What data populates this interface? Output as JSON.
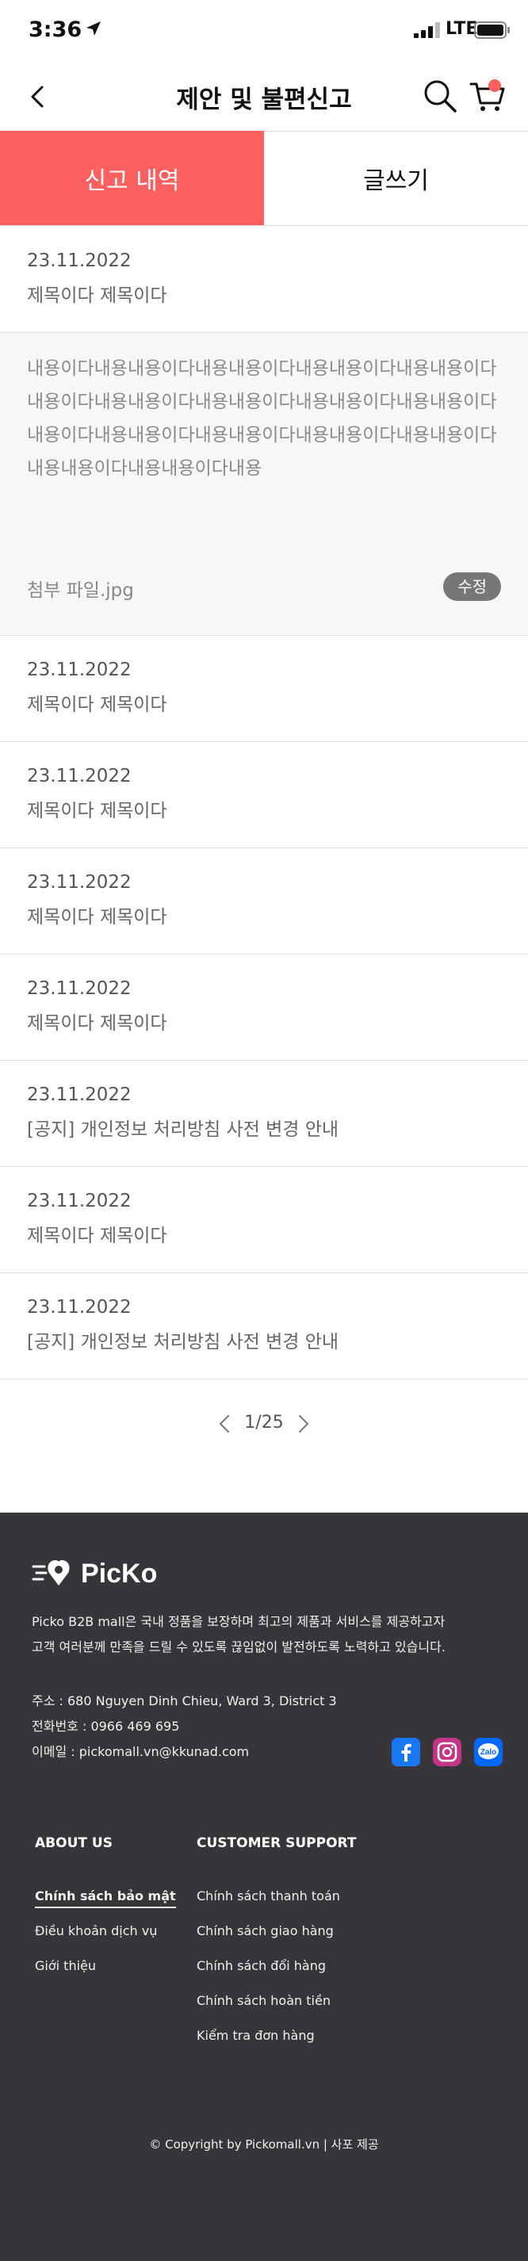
{
  "status_bar": {
    "time": "3:36",
    "network": "LTE"
  },
  "header": {
    "title": "제안 및 불편신고",
    "back_icon": "chevron-left-icon",
    "search_icon": "search-icon",
    "cart_icon": "cart-icon",
    "cart_badge_color": "#ff5f5f"
  },
  "tabs": [
    {
      "label": "신고 내역",
      "active": true
    },
    {
      "label": "글쓰기",
      "active": false
    }
  ],
  "colors": {
    "accent": "#fc6060",
    "footer_bg": "#37353a",
    "edit_button": "#777777"
  },
  "posts": [
    {
      "date": "23.11.2022",
      "title": "제목이다 제목이다",
      "expanded": true,
      "body": "내용이다내용내용이다내용내용이다내용내용이다내용내용이다내용이다내용내용이다내용내용이다내용내용이다내용내용이다내용이다내용내용이다내용내용이다내용내용이다내용내용이다내용내용이다내용내용이다내용",
      "attachment": "첨부 파일.jpg",
      "edit_label": "수정"
    },
    {
      "date": "23.11.2022",
      "title": "제목이다 제목이다"
    },
    {
      "date": "23.11.2022",
      "title": "제목이다 제목이다"
    },
    {
      "date": "23.11.2022",
      "title": "제목이다 제목이다"
    },
    {
      "date": "23.11.2022",
      "title": "제목이다 제목이다"
    },
    {
      "date": "23.11.2022",
      "title": "[공지] 개인정보 처리방침 사전 변경 안내"
    },
    {
      "date": "23.11.2022",
      "title": "제목이다 제목이다"
    },
    {
      "date": "23.11.2022",
      "title": "[공지] 개인정보 처리방침 사전 변경 안내"
    }
  ],
  "pagination": {
    "current": 1,
    "total": 25,
    "label": "1/25"
  },
  "footer": {
    "logo_text": "PicKo",
    "description_line1": "Picko B2B mall은 국내 정품을 보장하며 최고의 제품과 서비스를 제공하고자",
    "description_line2": "고객 여러분께 만족을 드릴 수 있도록 끊임없이 발전하도록 노력하고 있습니다.",
    "address": "주소 : 680 Nguyen Dinh Chieu, Ward 3, District 3",
    "phone": "전화번호 : 0966 469 695",
    "email": "이메일 : pickomall.vn@kkunad.com",
    "social_icons": [
      "facebook-icon",
      "instagram-icon",
      "zalo-icon"
    ],
    "zalo_label": "Zalo",
    "about_heading": "ABOUT US",
    "about_links": [
      "Chính sách bảo mật",
      "Điều khoản dịch vụ",
      "Giới thiệu"
    ],
    "support_heading": "CUSTOMER SUPPORT",
    "support_links": [
      "Chính sách thanh toán",
      "Chính sách giao hàng",
      "Chính sách đổi hàng",
      "Chính sách hoàn tiền",
      "Kiểm tra đơn hàng"
    ],
    "copyright": "© Copyright by Pickomall.vn | 사포 제공"
  }
}
